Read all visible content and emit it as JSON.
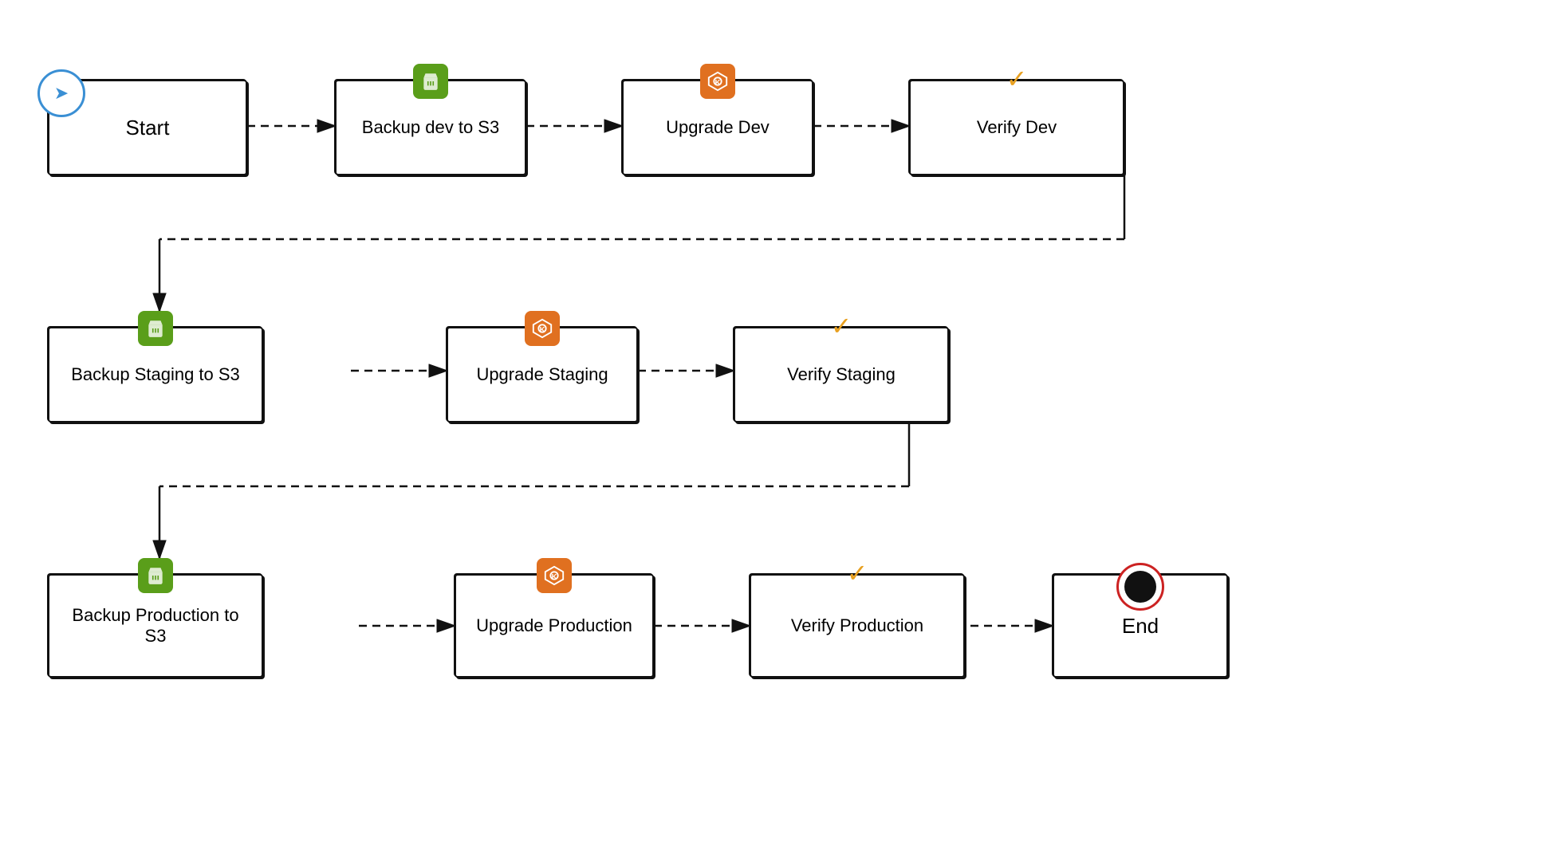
{
  "nodes": {
    "start": {
      "label": "Start"
    },
    "backup_dev": {
      "label": "Backup dev to S3"
    },
    "upgrade_dev": {
      "label": "Upgrade Dev"
    },
    "verify_dev": {
      "label": "Verify Dev"
    },
    "backup_staging": {
      "label": "Backup Staging to S3"
    },
    "upgrade_staging": {
      "label": "Upgrade Staging"
    },
    "verify_staging": {
      "label": "Verify Staging"
    },
    "backup_prod": {
      "label": "Backup Production to\nS3"
    },
    "upgrade_prod": {
      "label": "Upgrade Production"
    },
    "verify_prod": {
      "label": "Verify Production"
    },
    "end": {
      "label": "End"
    }
  },
  "icons": {
    "bucket": "🪣",
    "helm": "⬡",
    "check": "✓",
    "start_arrow": "➤"
  },
  "colors": {
    "green": "#5a9e1a",
    "orange": "#e07020",
    "gold": "#e8a020",
    "blue": "#3a8fd4",
    "red": "#cc2222"
  }
}
